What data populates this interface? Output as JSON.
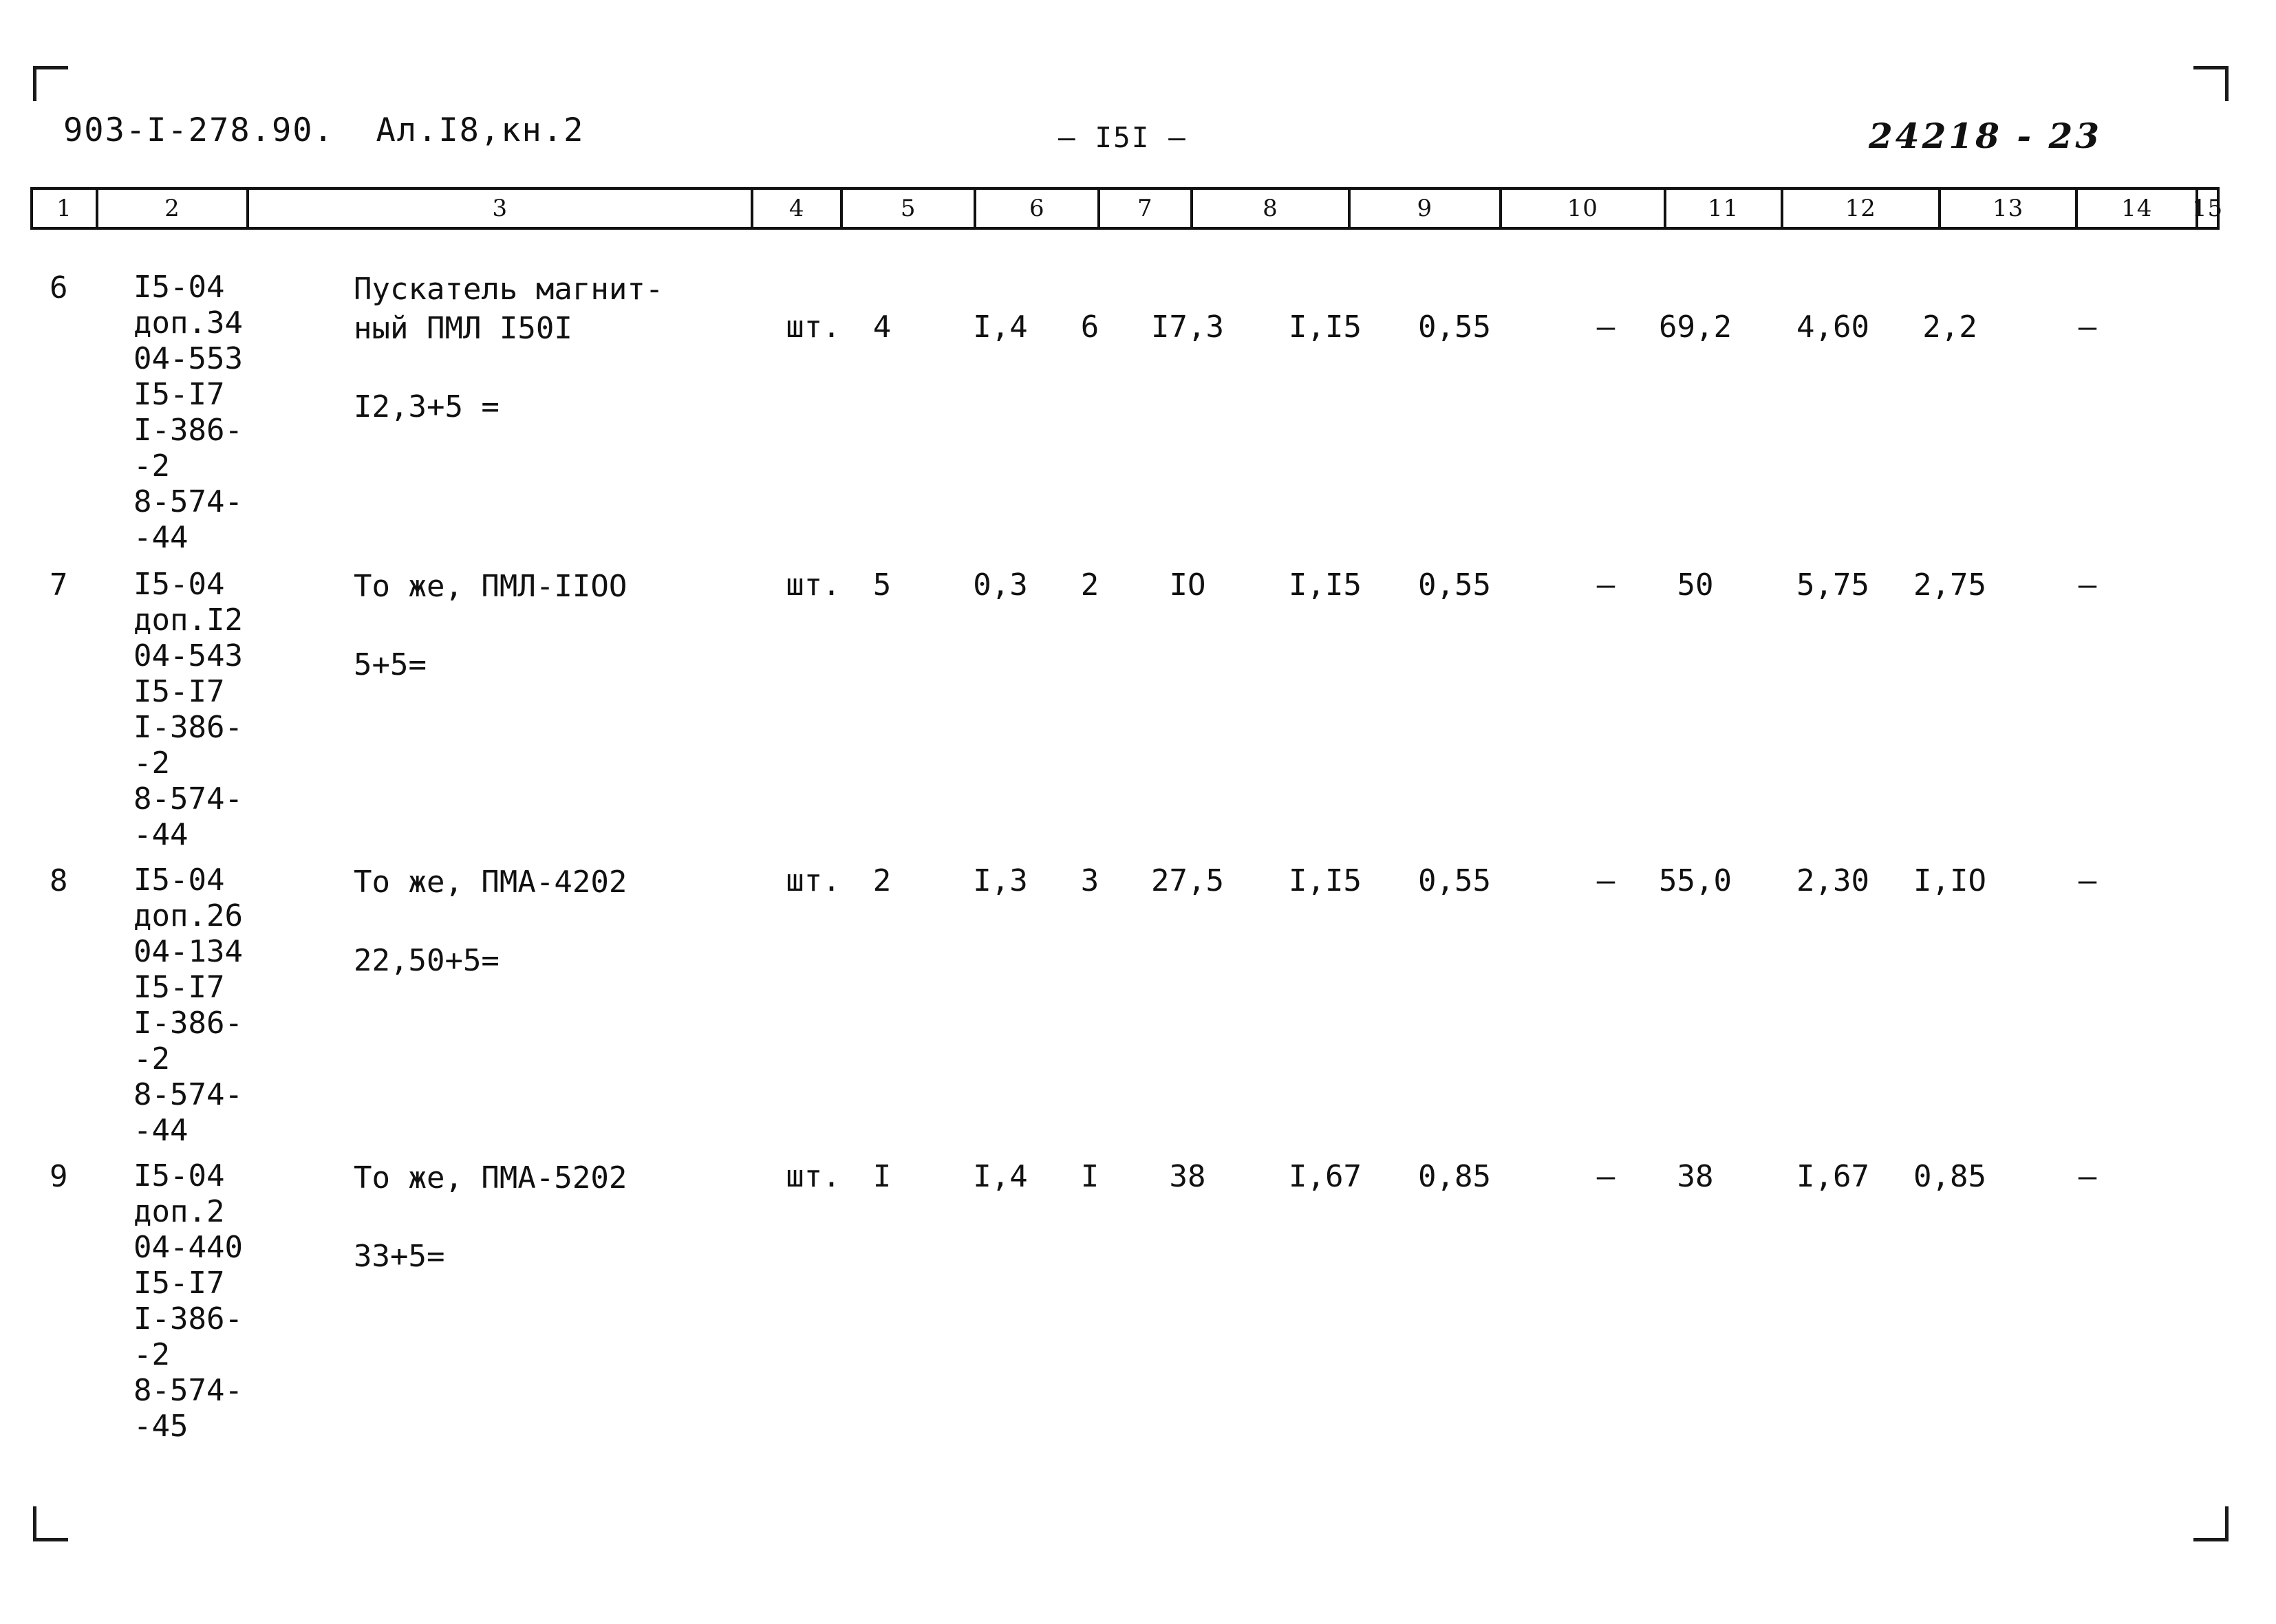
{
  "page": {
    "doc_code": "903-I-278.90.  Ал.I8,кн.2",
    "page_number": "— I5I —",
    "archive_number": "24218 - 23"
  },
  "table": {
    "column_headers": [
      "1",
      "2",
      "3",
      "4",
      "5",
      "6",
      "7",
      "8",
      "9",
      "10",
      "11",
      "12",
      "13",
      "14",
      "15"
    ],
    "rows": [
      {
        "c1": "6",
        "c2": [
          "I5-04",
          "доп.34",
          "04-553",
          "I5-I7",
          "I-386-",
          "-2",
          "8-574-",
          "-44"
        ],
        "c3": [
          "Пускатель магнит-",
          "ный ПМЛ I50I",
          "",
          "I2,3+5 ="
        ],
        "c4": "шт.",
        "c5": "4",
        "c6": "I,4",
        "c7": "6",
        "c8": "I7,3",
        "c9": "I,I5",
        "c10": "0,55",
        "c11": "–",
        "c12": "69,2",
        "c13": "4,60",
        "c14": "2,2",
        "c15": "–"
      },
      {
        "c1": "7",
        "c2": [
          "I5-04",
          "доп.I2",
          "04-543",
          "I5-I7",
          "I-386-",
          "-2",
          "8-574-",
          "-44"
        ],
        "c3": [
          "То же, ПМЛ-IIOO",
          "",
          "5+5="
        ],
        "c4": "шт.",
        "c5": "5",
        "c6": "0,3",
        "c7": "2",
        "c8": "IO",
        "c9": "I,I5",
        "c10": "0,55",
        "c11": "–",
        "c12": "50",
        "c13": "5,75",
        "c14": "2,75",
        "c15": "–"
      },
      {
        "c1": "8",
        "c2": [
          "I5-04",
          "доп.26",
          "04-134",
          "I5-I7",
          "I-386-",
          "-2",
          "8-574-",
          "-44"
        ],
        "c3": [
          "То же, ПМА-4202",
          "",
          "22,50+5="
        ],
        "c4": "шт.",
        "c5": "2",
        "c6": "I,3",
        "c7": "3",
        "c8": "27,5",
        "c9": "I,I5",
        "c10": "0,55",
        "c11": "–",
        "c12": "55,0",
        "c13": "2,30",
        "c14": "I,IO",
        "c15": "–"
      },
      {
        "c1": "9",
        "c2": [
          "I5-04",
          "доп.2",
          "04-440",
          "I5-I7",
          "I-386-",
          "-2",
          "8-574-",
          "-45"
        ],
        "c3": [
          "То же, ПМА-5202",
          "",
          "33+5="
        ],
        "c4": "шт.",
        "c5": "I",
        "c6": "I,4",
        "c7": "I",
        "c8": "38",
        "c9": "I,67",
        "c10": "0,85",
        "c11": "–",
        "c12": "38",
        "c13": "I,67",
        "c14": "0,85",
        "c15": "–"
      }
    ]
  }
}
